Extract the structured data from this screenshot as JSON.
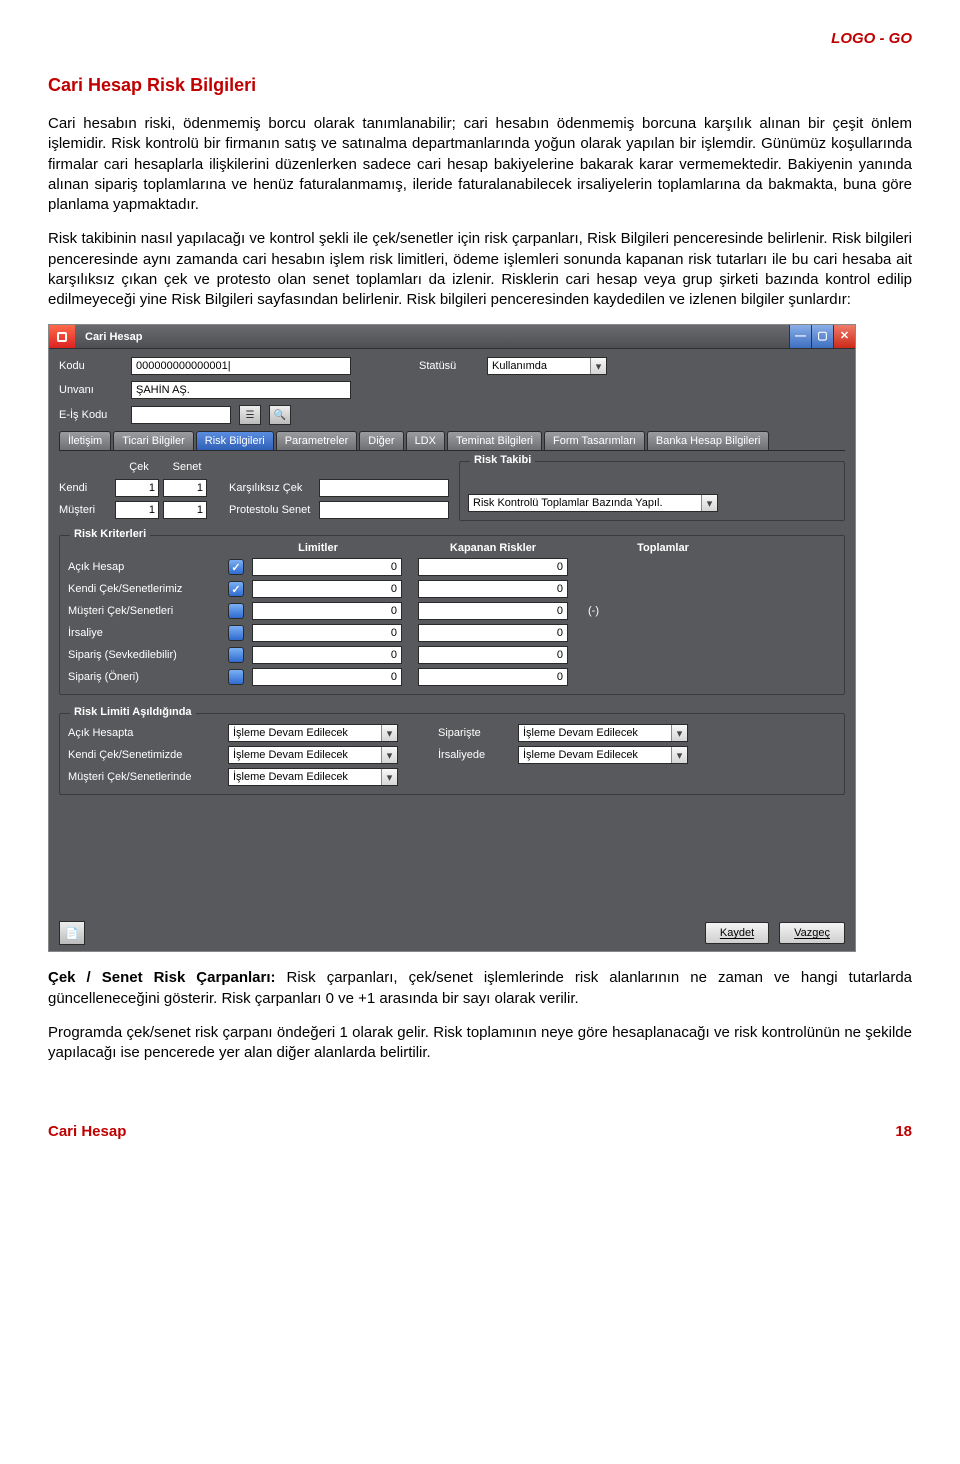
{
  "doc": {
    "header_right": "LOGO - GO",
    "section_title": "Cari Hesap Risk Bilgileri",
    "para1": "Cari hesabın riski, ödenmemiş borcu olarak tanımlanabilir; cari hesabın ödenmemiş borcuna karşılık alınan bir çeşit önlem işlemidir. Risk kontrolü bir firmanın satış ve satınalma departmanlarında yoğun olarak yapılan bir işlemdir. Günümüz koşullarında firmalar cari hesaplarla ilişkilerini düzenlerken sadece cari hesap bakiyelerine bakarak karar vermemektedir. Bakiyenin yanında alınan sipariş toplamlarına ve henüz faturalanmamış, ileride faturalanabilecek irsaliyelerin toplamlarına da bakmakta, buna göre planlama yapmaktadır.",
    "para2": "Risk takibinin nasıl yapılacağı ve kontrol şekli ile çek/senetler için risk çarpanları, Risk Bilgileri penceresinde belirlenir. Risk bilgileri penceresinde aynı zamanda cari hesabın işlem risk limitleri, ödeme işlemleri sonunda kapanan risk tutarları ile bu cari hesaba ait karşılıksız çıkan çek ve protesto olan senet toplamları da izlenir. Risklerin cari hesap veya grup şirketi bazında kontrol edilip edilmeyeceği yine Risk Bilgileri sayfasından belirlenir. Risk bilgileri penceresinden kaydedilen ve izlenen bilgiler şunlardır:",
    "para3_bold": "Çek / Senet Risk Çarpanları:",
    "para3_rest": " Risk çarpanları, çek/senet işlemlerinde risk alanlarının ne zaman ve hangi tutarlarda güncelleneceğini gösterir. Risk çarpanları 0 ve +1 arasında bir sayı olarak verilir.",
    "para4": "Programda çek/senet risk çarpanı öndeğeri 1 olarak gelir. Risk toplamının neye göre hesaplanacağı ve risk kontrolünün ne şekilde yapılacağı ise pencerede yer alan diğer alanlarda belirtilir.",
    "footer_left": "Cari Hesap",
    "footer_page": "18"
  },
  "dlg": {
    "title": "Cari Hesap",
    "labels": {
      "kodu": "Kodu",
      "unvani": "Unvanı",
      "eis": "E-İş Kodu",
      "statu": "Statüsü"
    },
    "values": {
      "kodu": "000000000000001|",
      "unvani": "ŞAHİN AŞ.",
      "eis": "",
      "statu": "Kullanımda"
    },
    "tabs": [
      "İletişim",
      "Ticari Bilgiler",
      "Risk Bilgileri",
      "Parametreler",
      "Diğer",
      "LDX",
      "Teminat Bilgileri",
      "Form Tasarımları",
      "Banka Hesap Bilgileri"
    ],
    "active_tab_index": 2,
    "carpan": {
      "col1": "Çek",
      "col2": "Senet",
      "rows": [
        {
          "label": "Kendi",
          "c": "1",
          "s": "1"
        },
        {
          "label": "Müşteri",
          "c": "1",
          "s": "1"
        }
      ]
    },
    "mid": {
      "rows": [
        {
          "label": "Karşılıksız Çek",
          "val": ""
        },
        {
          "label": "Protestolu Senet",
          "val": ""
        }
      ]
    },
    "risk_takibi": {
      "legend": "Risk Takibi",
      "value": "Risk Kontrolü Toplamlar Bazında Yapıl."
    },
    "risk_kriterleri": {
      "legend": "Risk Kriterleri",
      "headers": {
        "lim": "Limitler",
        "kap": "Kapanan Riskler",
        "top": "Toplamlar"
      },
      "rows": [
        {
          "label": "Açık Hesap",
          "chk": true,
          "lim": "0",
          "kap": "0",
          "neg": ""
        },
        {
          "label": "Kendi Çek/Senetlerimiz",
          "chk": true,
          "lim": "0",
          "kap": "0",
          "neg": ""
        },
        {
          "label": "Müşteri Çek/Senetleri",
          "chk": false,
          "lim": "0",
          "kap": "0",
          "neg": "(-)"
        },
        {
          "label": "İrsaliye",
          "chk": false,
          "lim": "0",
          "kap": "0",
          "neg": ""
        },
        {
          "label": "Sipariş (Sevkedilebilir)",
          "chk": false,
          "lim": "0",
          "kap": "0",
          "neg": ""
        },
        {
          "label": "Sipariş (Öneri)",
          "chk": false,
          "lim": "0",
          "kap": "0",
          "neg": ""
        }
      ]
    },
    "asildi": {
      "legend": "Risk Limiti Aşıldığında",
      "left": [
        {
          "label": "Açık Hesapta",
          "val": "İşleme Devam Edilecek"
        },
        {
          "label": "Kendi Çek/Senetimizde",
          "val": "İşleme Devam Edilecek"
        },
        {
          "label": "Müşteri Çek/Senetlerinde",
          "val": "İşleme Devam Edilecek"
        }
      ],
      "right": [
        {
          "label": "Siparişte",
          "val": "İşleme Devam Edilecek"
        },
        {
          "label": "İrsaliyede",
          "val": "İşleme Devam Edilecek"
        }
      ]
    },
    "buttons": {
      "save": "Kaydet",
      "cancel": "Vazgeç"
    }
  }
}
